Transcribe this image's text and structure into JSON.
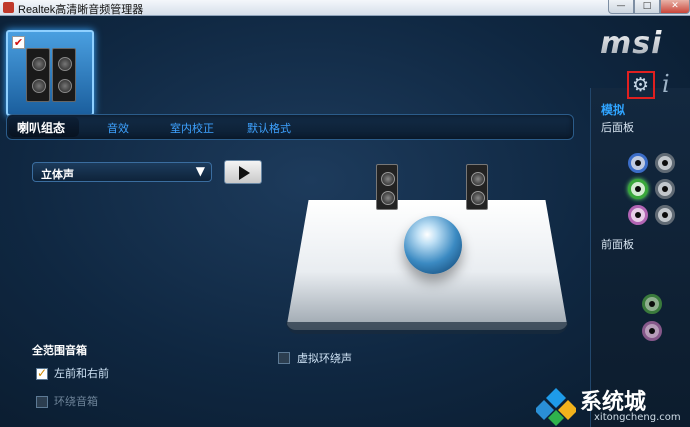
{
  "window": {
    "title": "Realtek高清晰音频管理器",
    "minimize": "—",
    "maximize": "□",
    "close": "✕"
  },
  "device": {
    "checked": true,
    "check_glyph": "✔"
  },
  "tabs": [
    {
      "label": "喇叭组态",
      "active": true
    },
    {
      "label": "音效",
      "active": false
    },
    {
      "label": "室内校正",
      "active": false
    },
    {
      "label": "默认格式",
      "active": false
    }
  ],
  "speaker_config": {
    "selected": "立体声",
    "dropdown_arrow": "▼"
  },
  "virtual_surround": {
    "label": "虚拟环绕声",
    "checked": false
  },
  "full_range": {
    "title": "全范围音箱",
    "options": [
      {
        "label": "左前和右前",
        "checked": true
      },
      {
        "label": "环绕音箱",
        "checked": false
      }
    ]
  },
  "sidebar": {
    "logo": "msi",
    "settings_glyph": "⚙",
    "info_glyph": "i",
    "analog_label": "模拟",
    "rear_panel_label": "后面板",
    "front_panel_label": "前面板"
  },
  "watermark": {
    "text": "系统城",
    "sub": "xitongcheng.com"
  },
  "colors": {
    "accent_blue": "#3ea2ff",
    "jack_blue": "#3b6dc8",
    "jack_green": "#39a73b",
    "jack_pink": "#b164b3",
    "highlight_red": "#e02020"
  }
}
